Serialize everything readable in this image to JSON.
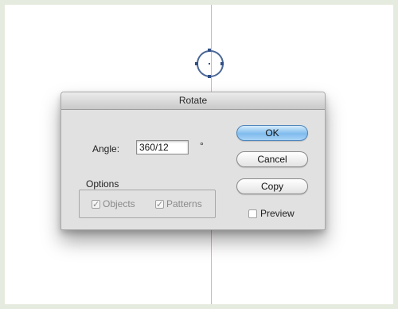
{
  "dialog": {
    "title": "Rotate",
    "angle_label": "Angle:",
    "angle_value": "360/12",
    "degree_symbol": "°",
    "buttons": {
      "ok": "OK",
      "cancel": "Cancel",
      "copy": "Copy"
    },
    "options": {
      "label": "Options",
      "objects": {
        "label": "Objects",
        "checked": true,
        "enabled": false
      },
      "patterns": {
        "label": "Patterns",
        "checked": true,
        "enabled": false
      }
    },
    "preview": {
      "label": "Preview",
      "checked": false
    }
  },
  "colors": {
    "guide": "#8fd0dd",
    "circle_stroke": "#4a6796",
    "ok_button": "#7fbbee"
  },
  "icons": {
    "check": "checkmark-icon"
  }
}
